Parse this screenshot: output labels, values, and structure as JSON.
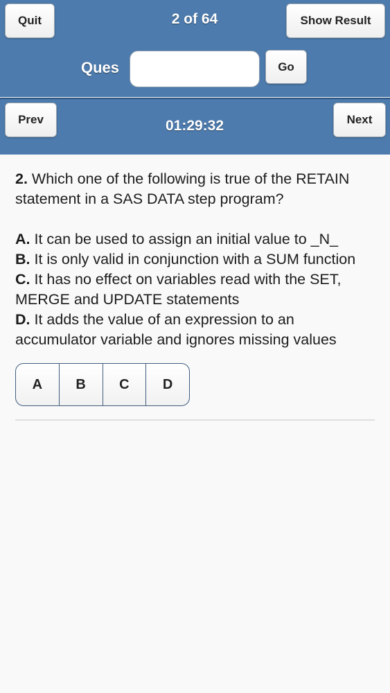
{
  "header": {
    "quit_label": "Quit",
    "progress": "2 of 64",
    "show_result_label": "Show Result",
    "ques_label": "Ques",
    "ques_input_value": "",
    "go_label": "Go"
  },
  "navbar": {
    "prev_label": "Prev",
    "timer": "01:29:32",
    "next_label": "Next"
  },
  "question": {
    "number": "2.",
    "text": "Which one of the following is true of the RETAIN statement in a SAS DATA step program?",
    "options": [
      {
        "letter": "A.",
        "text": "It can be used to assign an initial value to _N_"
      },
      {
        "letter": "B.",
        "text": "It is only valid in conjunction with a SUM function"
      },
      {
        "letter": "C.",
        "text": "It has no effect on variables read with the SET, MERGE and UPDATE statements"
      },
      {
        "letter": "D.",
        "text": "It adds the value of an expression to an accumulator variable and ignores missing values"
      }
    ]
  },
  "answers": [
    "A",
    "B",
    "C",
    "D"
  ],
  "colors": {
    "header_bg": "#4d7bad",
    "page_bg": "#f9f9f9",
    "button_border": "#3f5d7d"
  }
}
